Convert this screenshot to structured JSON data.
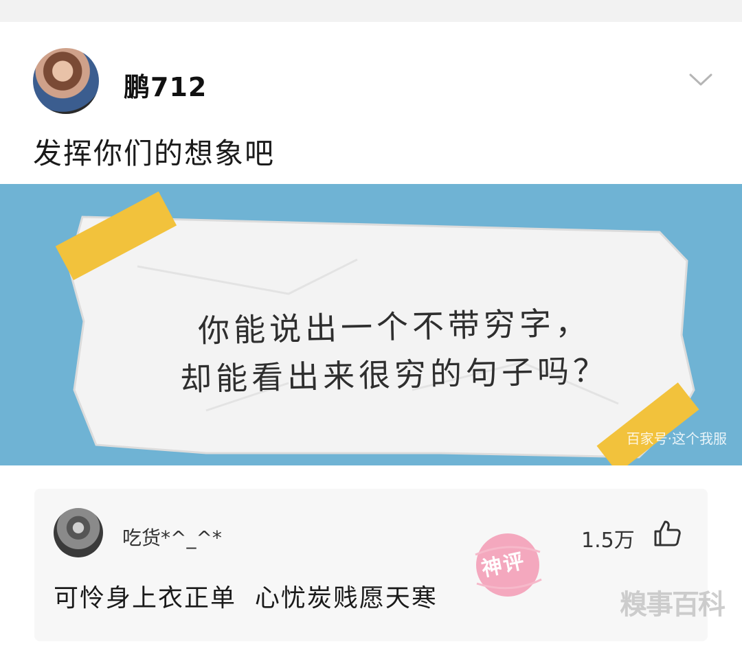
{
  "post": {
    "username": "鹏712",
    "text": "发挥你们的想象吧",
    "menu_icon": "chevron-down-icon"
  },
  "photo": {
    "note_line1": "你能说出一个不带穷字，",
    "note_line2": "却能看出来很穷的句子吗？",
    "watermark": "百家号·这个我服",
    "colors": {
      "background": "#6fb3d4",
      "paper": "#f4f4f4",
      "tape": "#f2c23c"
    }
  },
  "comment": {
    "username": "吃货*^_^*",
    "likes": "1.5万",
    "like_icon": "thumbs-up-icon",
    "text": "可怜身上衣正单  心忧炭贱愿天寒",
    "badge": "神评",
    "badge_color": "#f39ab4"
  },
  "watermark": {
    "text": "糗事百科"
  }
}
